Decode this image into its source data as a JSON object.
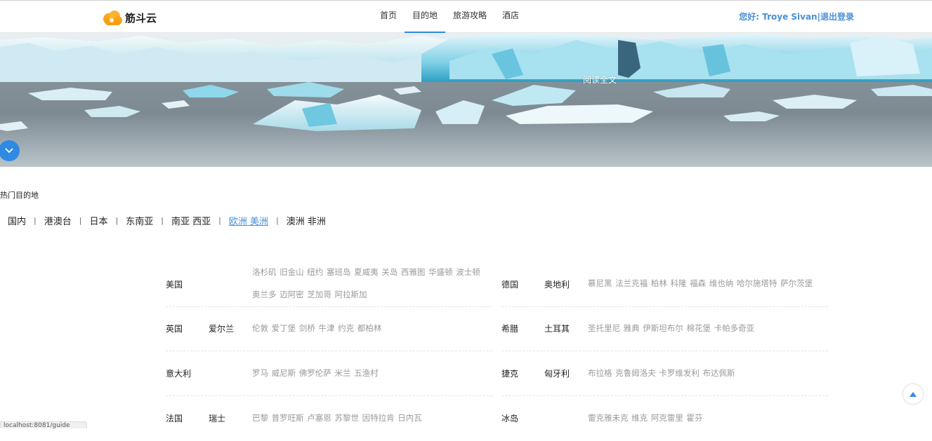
{
  "header": {
    "logo_text": "筋斗云",
    "nav": [
      {
        "label": "首页"
      },
      {
        "label": "目的地"
      },
      {
        "label": "旅游攻略"
      },
      {
        "label": "酒店"
      }
    ],
    "greeting": "您好:  Troye Sivan|",
    "logout": "退出登录"
  },
  "banner": {
    "read_more": "阅读全文"
  },
  "hot": {
    "title": "热门目的地",
    "tabs": [
      {
        "label": "国内"
      },
      {
        "label": "港澳台"
      },
      {
        "label": "日本"
      },
      {
        "label": "东南亚"
      },
      {
        "label": "南亚 西亚"
      },
      {
        "label": "欧洲 美洲"
      },
      {
        "label": "澳洲 非洲"
      }
    ],
    "separator": "|",
    "active_tab": "欧洲 美洲"
  },
  "destinations": {
    "left": [
      {
        "c1": "美国",
        "c2": "",
        "cities": "洛杉矶 旧金山 纽约 塞班岛 夏威夷 关岛 西雅图 华盛顿 波士顿 奥兰多 迈阿密 芝加哥 阿拉斯加"
      },
      {
        "c1": "英国",
        "c2": "爱尔兰",
        "cities": "伦敦 爱丁堡 剑桥 牛津 约克 都柏林"
      },
      {
        "c1": "意大利",
        "c2": "",
        "cities": "罗马 威尼斯 佛罗伦萨 米兰 五渔村"
      },
      {
        "c1": "法国",
        "c2": "瑞士",
        "cities": "巴黎 普罗旺斯 卢塞恩 苏黎世 因特拉肯 日内瓦"
      }
    ],
    "right": [
      {
        "c1": "德国",
        "c2": "奥地利",
        "cities": "慕尼黑 法兰克福 柏林 科隆 福森 维也纳 哈尔施塔特 萨尔茨堡"
      },
      {
        "c1": "希腊",
        "c2": "土耳其",
        "cities": "圣托里尼 雅典 伊斯坦布尔 棉花堡 卡帕多奇亚"
      },
      {
        "c1": "捷克",
        "c2": "匈牙利",
        "cities": "布拉格 克鲁姆洛夫 卡罗维发利 布达佩斯"
      },
      {
        "c1": "冰岛",
        "c2": "",
        "cities": "雷克雅未克 维克 阿克雷里 霍芬"
      }
    ]
  },
  "status": "localhost:8081/guide",
  "colors": {
    "accent": "#2f8ae3",
    "link": "#4a8fd8",
    "muted_text": "#9a9a9a"
  }
}
